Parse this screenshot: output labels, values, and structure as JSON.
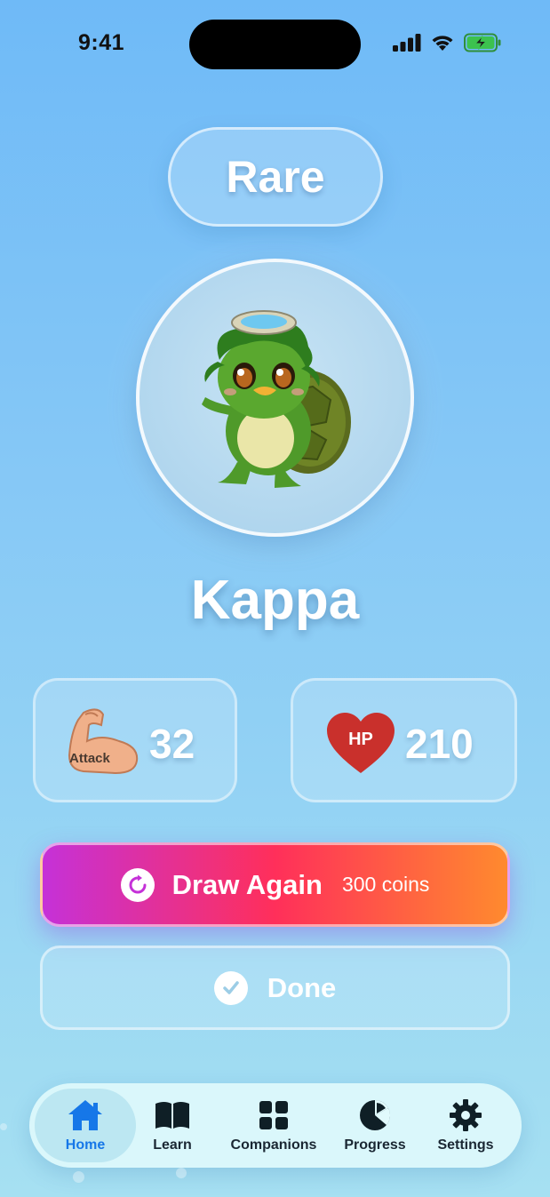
{
  "status_bar": {
    "time": "9:41"
  },
  "rarity": {
    "label": "Rare"
  },
  "creature": {
    "name": "Kappa",
    "image": "kappa-turtle-creature"
  },
  "stats": {
    "attack": {
      "icon_text": "Attack",
      "value": "32",
      "icon": "flexed-arm-icon"
    },
    "hp": {
      "icon_text": "HP",
      "value": "210",
      "icon": "heart-icon"
    }
  },
  "actions": {
    "draw_again": {
      "label": "Draw Again",
      "cost": "300 coins",
      "icon": "refresh-icon"
    },
    "done": {
      "label": "Done",
      "icon": "checkmark-icon"
    }
  },
  "tab_bar": {
    "active": "Home",
    "items": [
      {
        "label": "Home",
        "icon": "house-icon"
      },
      {
        "label": "Learn",
        "icon": "book-icon"
      },
      {
        "label": "Companions",
        "icon": "grid-icon"
      },
      {
        "label": "Progress",
        "icon": "pie-chart-icon"
      },
      {
        "label": "Settings",
        "icon": "gear-icon"
      }
    ]
  },
  "colors": {
    "accent_blue": "#1677e8",
    "gradient_start": "#c531d8",
    "gradient_mid": "#ff2f5a",
    "gradient_end": "#ff8a2e",
    "hp_red": "#c9302c"
  }
}
